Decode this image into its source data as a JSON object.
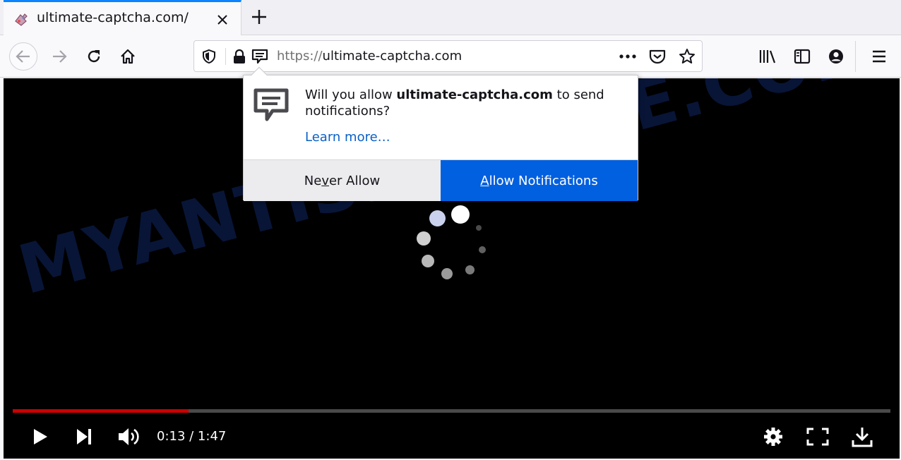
{
  "tab": {
    "title": "ultimate-captcha.com/",
    "favicon": "puzzle-favicon-icon"
  },
  "toolbar": {
    "url_scheme": "https://",
    "url_host": "ultimate-captcha.com"
  },
  "popup": {
    "prefix": "Will you allow ",
    "site": "ultimate-captcha.com",
    "suffix": " to send notifications?",
    "learn_more": "Learn more…",
    "never_pre": "Ne",
    "never_key": "v",
    "never_post": "er Allow",
    "allow_key": "A",
    "allow_post": "llow Notifications"
  },
  "video": {
    "watermark": "MYANTISPYWARE.COM",
    "time": "0:13 / 1:47",
    "progress": 0.2
  },
  "colors": {
    "accent": "#0060df",
    "progress": "#cc0000",
    "link": "#0a60c8"
  }
}
